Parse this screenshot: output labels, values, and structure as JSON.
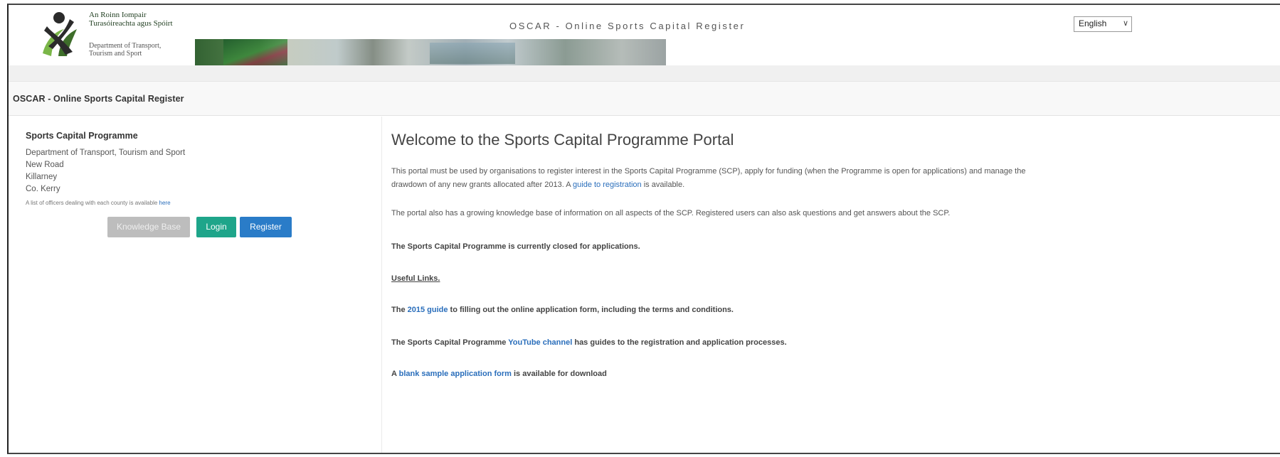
{
  "header": {
    "dept_irish_line1": "An Roinn Iompair",
    "dept_irish_line2": "Turasóireachta agus Spóirt",
    "dept_english_line1": "Department of Transport,",
    "dept_english_line2": "Tourism and Sport",
    "title": "OSCAR - Online Sports Capital Register",
    "language": "English"
  },
  "panel": {
    "heading": "OSCAR - Online Sports Capital Register"
  },
  "sidebar": {
    "title": "Sports Capital Programme",
    "address": [
      "Department of Transport, Tourism and Sport",
      "New Road",
      "Killarney",
      "Co. Kerry"
    ],
    "officers_text": "A list of officers dealing with each county is available",
    "officers_link": "here",
    "buttons": {
      "knowledge_base": "Knowledge Base",
      "login": "Login",
      "register": "Register"
    }
  },
  "main": {
    "welcome": "Welcome to the Sports Capital Programme Portal",
    "intro_line1": "This portal must be used by organisations to register interest in the Sports Capital Programme (SCP), apply for funding (when the Programme is open for applications) and manage the",
    "intro_line2_before": "drawdown of any new grants allocated after 2013. A",
    "intro_link": "guide to registration",
    "intro_line2_after": "is available.",
    "knowledge_text": "The portal also has a growing knowledge base of information on all aspects of the SCP. Registered users can also ask questions and get answers about the SCP.",
    "closed_text": "The Sports Capital Programme is currently closed for applications.",
    "useful_links": "Useful Links.",
    "guide_before": "The",
    "guide_link": "2015 guide",
    "guide_after": "to filling out the online application form, including the terms and conditions.",
    "youtube_before": "The Sports Capital Programme",
    "youtube_link": "YouTube channel",
    "youtube_after": "has guides to the registration and application processes.",
    "sample_before": "A",
    "sample_link": "blank sample application form",
    "sample_after": "is available for download"
  },
  "colors": {
    "link": "#2a6ebb",
    "login_button": "#1ea58a",
    "register_button": "#2a7cc8",
    "knowledge_button": "#bdbdbd"
  }
}
